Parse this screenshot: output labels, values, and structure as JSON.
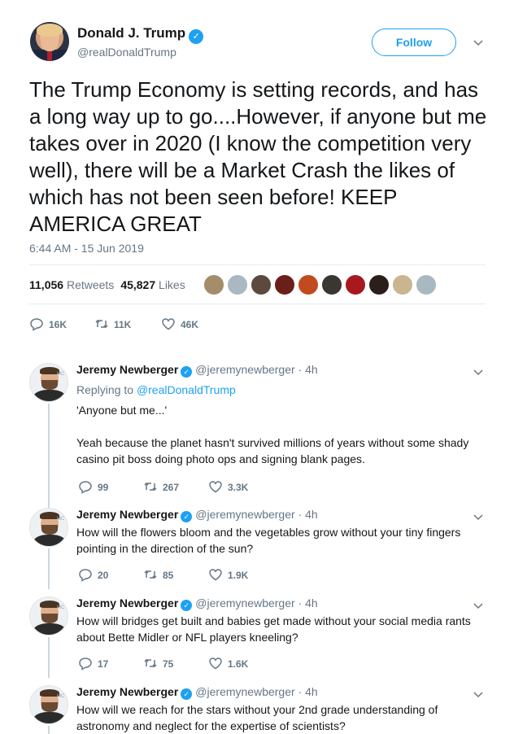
{
  "main": {
    "author_name": "Donald J. Trump",
    "author_handle": "@realDonaldTrump",
    "follow_label": "Follow",
    "text": "The Trump Economy is setting records, and has a long way up to go....However, if anyone but me takes over in 2020 (I know the competition very well), there will be a Market Crash the likes of which has not been seen before! KEEP AMERICA GREAT",
    "timestamp": "6:44 AM - 15 Jun 2019",
    "retweets_count": "11,056",
    "retweets_label": "Retweets",
    "likes_count": "45,827",
    "likes_label": "Likes",
    "actions": {
      "replies": "16K",
      "retweets": "11K",
      "likes": "46K"
    }
  },
  "colors": {
    "accent": "#1da1f2",
    "muted": "#657786",
    "divider": "#e6ecf0"
  },
  "replies": [
    {
      "name": "Jeremy Newberger",
      "handle": "@jeremynewberger",
      "time": "· 4h",
      "replying_prefix": "Replying to",
      "replying_to": "@realDonaldTrump",
      "text": "'Anyone but me...'\n\nYeah because the planet hasn't survived millions of years without some shady casino pit boss doing photo ops and signing blank pages.",
      "replies": "99",
      "retweets": "267",
      "likes": "3.3K"
    },
    {
      "name": "Jeremy Newberger",
      "handle": "@jeremynewberger",
      "time": "· 4h",
      "text": "How will the flowers bloom and the vegetables grow without your tiny fingers pointing in the direction of the sun?",
      "replies": "20",
      "retweets": "85",
      "likes": "1.9K"
    },
    {
      "name": "Jeremy Newberger",
      "handle": "@jeremynewberger",
      "time": "· 4h",
      "text": "How will bridges get built and babies get made without your social media rants about Bette Midler or NFL players kneeling?",
      "replies": "17",
      "retweets": "75",
      "likes": "1.6K"
    },
    {
      "name": "Jeremy Newberger",
      "handle": "@jeremynewberger",
      "time": "· 4h",
      "text": "How will we reach for the stars without your 2nd grade understanding of astronomy and neglect for the expertise of scientists?"
    }
  ]
}
